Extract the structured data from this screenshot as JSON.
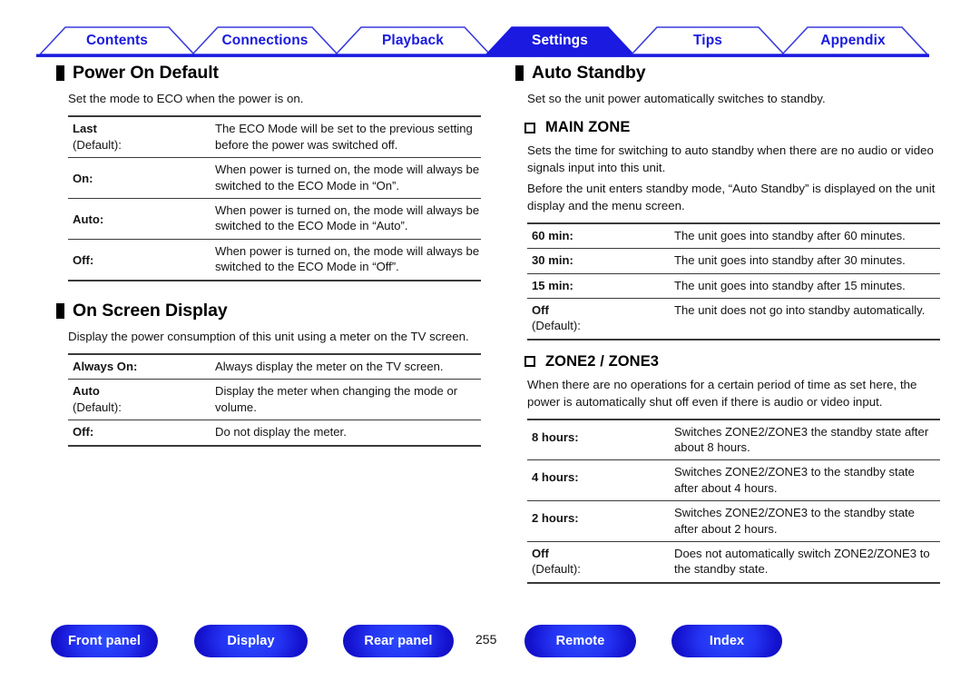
{
  "tabs": [
    {
      "label": "Contents",
      "active": false
    },
    {
      "label": "Connections",
      "active": false
    },
    {
      "label": "Playback",
      "active": false
    },
    {
      "label": "Settings",
      "active": true
    },
    {
      "label": "Tips",
      "active": false
    },
    {
      "label": "Appendix",
      "active": false
    }
  ],
  "colors": {
    "tab_blue": "#1a1ae0",
    "tab_active_bg": "#1a1ae0",
    "tab_active_text": "#ffffff",
    "rule": "#1a1ae0",
    "button_blue": "#2433f2",
    "text": "#141414"
  },
  "left_column": {
    "sections": [
      {
        "marker": "black-square-marker",
        "title": "Power On Default",
        "intro": "Set the mode to ECO when the power is on.",
        "rows": [
          {
            "term": "Last",
            "term_sub": "(Default):",
            "desc": "The ECO Mode will be set to the previous setting before the power was switched off."
          },
          {
            "term": "On:",
            "term_sub": "",
            "desc": "When power is turned on, the mode will always be switched to the ECO Mode in “On”."
          },
          {
            "term": "Auto:",
            "term_sub": "",
            "desc": "When power is turned on, the mode will always be switched to the ECO Mode in “Auto”."
          },
          {
            "term": "Off:",
            "term_sub": "",
            "desc": "When power is turned on, the mode will always be switched to the ECO Mode in “Off”."
          }
        ]
      },
      {
        "marker": "black-square-marker",
        "title": "On Screen Display",
        "intro": "Display the power consumption of this unit using a meter on the TV screen.",
        "rows": [
          {
            "term": "Always On:",
            "term_sub": "",
            "desc": "Always display the meter on the TV screen."
          },
          {
            "term": "Auto",
            "term_sub": "(Default):",
            "desc": "Display the meter when changing the mode or volume."
          },
          {
            "term": "Off:",
            "term_sub": "",
            "desc": "Do not display the meter."
          }
        ]
      }
    ]
  },
  "right_column": {
    "section": {
      "marker": "black-square-marker",
      "title": "Auto Standby",
      "intro": "Set so the unit power automatically switches to standby."
    },
    "subsections": [
      {
        "marker": "hollow-square-marker",
        "title": "MAIN ZONE",
        "paragraphs": [
          "Sets the time for switching to auto standby when there are no audio or video signals input into this unit.",
          "Before the unit enters standby mode, “Auto Standby” is displayed on the unit display and the menu screen."
        ],
        "rows": [
          {
            "term": "60 min:",
            "term_sub": "",
            "desc": "The unit goes into standby after 60 minutes."
          },
          {
            "term": "30 min:",
            "term_sub": "",
            "desc": "The unit goes into standby after 30 minutes."
          },
          {
            "term": "15 min:",
            "term_sub": "",
            "desc": "The unit goes into standby after 15 minutes."
          },
          {
            "term": "Off",
            "term_sub": "(Default):",
            "desc": "The unit does not go into standby automatically."
          }
        ]
      },
      {
        "marker": "hollow-square-marker",
        "title": "ZONE2 / ZONE3",
        "paragraphs": [
          "When there are no operations for a certain period of time as set here, the power is automatically shut off even if there is audio or video input."
        ],
        "rows": [
          {
            "term": "8 hours:",
            "term_sub": "",
            "desc": "Switches ZONE2/ZONE3 the standby state after about 8 hours."
          },
          {
            "term": "4 hours:",
            "term_sub": "",
            "desc": "Switches ZONE2/ZONE3 to the standby state after about 4 hours."
          },
          {
            "term": "2 hours:",
            "term_sub": "",
            "desc": "Switches ZONE2/ZONE3 to the standby state after about 2 hours."
          },
          {
            "term": "Off",
            "term_sub": "(Default):",
            "desc": "Does not automatically switch ZONE2/ZONE3 to the standby state."
          }
        ]
      }
    ]
  },
  "footer": {
    "buttons": [
      {
        "label": "Front panel"
      },
      {
        "label": "Display"
      },
      {
        "label": "Rear panel"
      },
      {
        "label": "Remote"
      },
      {
        "label": "Index"
      }
    ],
    "page_number": "255"
  }
}
